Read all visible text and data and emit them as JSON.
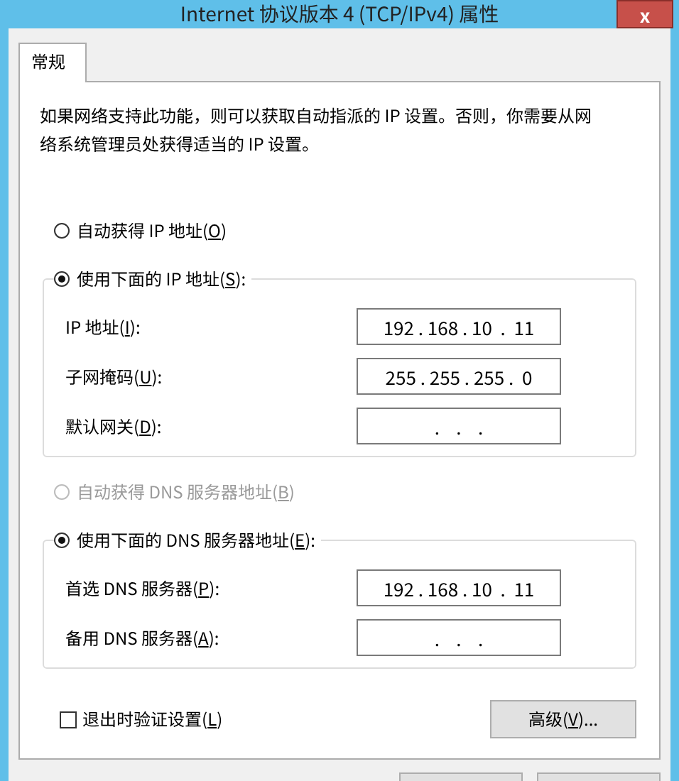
{
  "window": {
    "title": "Internet 协议版本 4 (TCP/IPv4) 属性",
    "close": "x"
  },
  "tabs": [
    {
      "label": "常规",
      "selected": true
    }
  ],
  "description": "如果网络支持此功能，则可以获取自动指派的 IP 设置。否则，你需要从网络系统管理员处获得适当的 IP 设置。",
  "ip_mode": [
    {
      "label": "自动获得 IP 地址(O)",
      "selected": false,
      "disabled": false
    },
    {
      "label": "使用下面的 IP 地址(S):",
      "selected": true,
      "disabled": false
    }
  ],
  "ip_fields": [
    {
      "label": "IP 地址(I):",
      "value": "192 . 168 . 10  .  11"
    },
    {
      "label": "子网掩码(U):",
      "value": "255 . 255 . 255 .  0"
    },
    {
      "label": "默认网关(D):",
      "value": ".    .    ."
    }
  ],
  "dns_mode": [
    {
      "label": "自动获得 DNS 服务器地址(B)",
      "selected": false,
      "disabled": true
    },
    {
      "label": "使用下面的 DNS 服务器地址(E):",
      "selected": true,
      "disabled": false
    }
  ],
  "dns_fields": [
    {
      "label": "首选 DNS 服务器(P):",
      "value": "192 . 168 . 10  .  11"
    },
    {
      "label": "备用 DNS 服务器(A):",
      "value": ".    .    ."
    }
  ],
  "validate_checkbox": {
    "label": "退出时验证设置(L)",
    "checked": false
  },
  "advanced_button": "高级(V)..."
}
